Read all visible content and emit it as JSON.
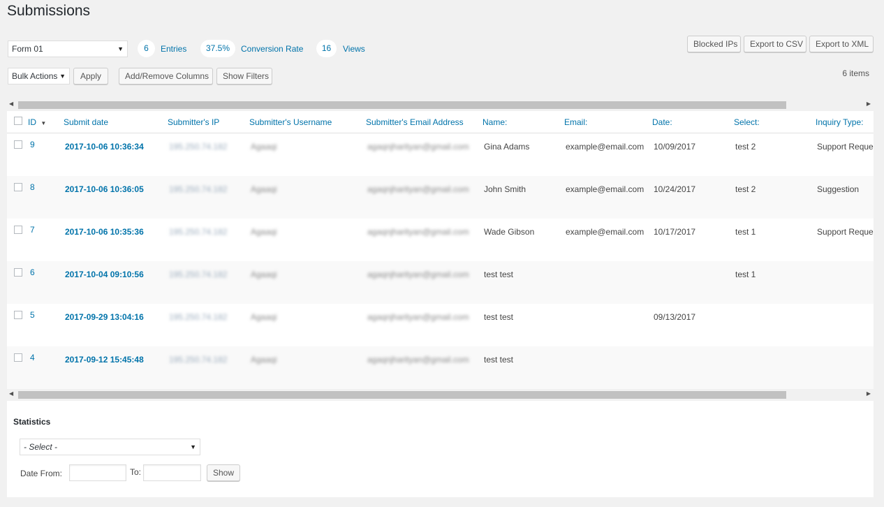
{
  "page": {
    "title": "Submissions"
  },
  "form_select": {
    "value": "Form 01"
  },
  "stats_pills": [
    {
      "value": "6",
      "label": "Entries"
    },
    {
      "value": "37.5%",
      "label": "Conversion Rate"
    },
    {
      "value": "16",
      "label": "Views"
    }
  ],
  "top_buttons": {
    "blocked": "Blocked IPs",
    "csv": "Export to CSV",
    "xml": "Export to XML"
  },
  "actions": {
    "bulk": "Bulk Actions",
    "apply": "Apply",
    "columns": "Add/Remove Columns",
    "filters": "Show Filters",
    "item_count": "6 items"
  },
  "table": {
    "columns": [
      "ID",
      "Submit date",
      "Submitter's IP",
      "Submitter's Username",
      "Submitter's Email Address",
      "Name:",
      "Email:",
      "Date:",
      "Select:",
      "Inquiry Type:"
    ],
    "sort_indicator": "▼",
    "rows": [
      {
        "id": "9",
        "date": "2017-10-06 10:36:34",
        "ip": "195.250.74.182",
        "user": "Agaaqi",
        "useremail": "agaqnjharityan@gmail.com",
        "name": "Gina Adams",
        "email": "example@email.com",
        "fdate": "10/09/2017",
        "select": "test 2",
        "inquiry": "Support Request"
      },
      {
        "id": "8",
        "date": "2017-10-06 10:36:05",
        "ip": "195.250.74.182",
        "user": "Agaaqi",
        "useremail": "agaqnjharityan@gmail.com",
        "name": "John Smith",
        "email": "example@email.com",
        "fdate": "10/24/2017",
        "select": "test 2",
        "inquiry": "Suggestion"
      },
      {
        "id": "7",
        "date": "2017-10-06 10:35:36",
        "ip": "195.250.74.182",
        "user": "Agaaqi",
        "useremail": "agaqnjharityan@gmail.com",
        "name": "Wade Gibson",
        "email": "example@email.com",
        "fdate": "10/17/2017",
        "select": "test 1",
        "inquiry": "Support Request"
      },
      {
        "id": "6",
        "date": "2017-10-04 09:10:56",
        "ip": "195.250.74.182",
        "user": "Agaaqi",
        "useremail": "agaqnjharityan@gmail.com",
        "name": "test test",
        "email": "",
        "fdate": "",
        "select": "test 1",
        "inquiry": ""
      },
      {
        "id": "5",
        "date": "2017-09-29 13:04:16",
        "ip": "195.250.74.182",
        "user": "Agaaqi",
        "useremail": "agaqnjharityan@gmail.com",
        "name": "test test",
        "email": "",
        "fdate": "09/13/2017",
        "select": "",
        "inquiry": ""
      },
      {
        "id": "4",
        "date": "2017-09-12 15:45:48",
        "ip": "195.250.74.182",
        "user": "Agaaqi",
        "useremail": "agaqnjharityan@gmail.com",
        "name": "test test",
        "email": "",
        "fdate": "",
        "select": "",
        "inquiry": ""
      }
    ]
  },
  "statistics": {
    "heading": "Statistics",
    "select": "- Select -",
    "date_from_label": "Date From:",
    "to_label": "To:",
    "show": "Show"
  },
  "icons": {
    "caret": "caret-down-icon",
    "scroll_left": "arrow-left-icon",
    "scroll_right": "arrow-right-icon"
  },
  "colors": {
    "link": "#0073aa",
    "background": "#f1f1f1",
    "panel": "#ffffff"
  }
}
